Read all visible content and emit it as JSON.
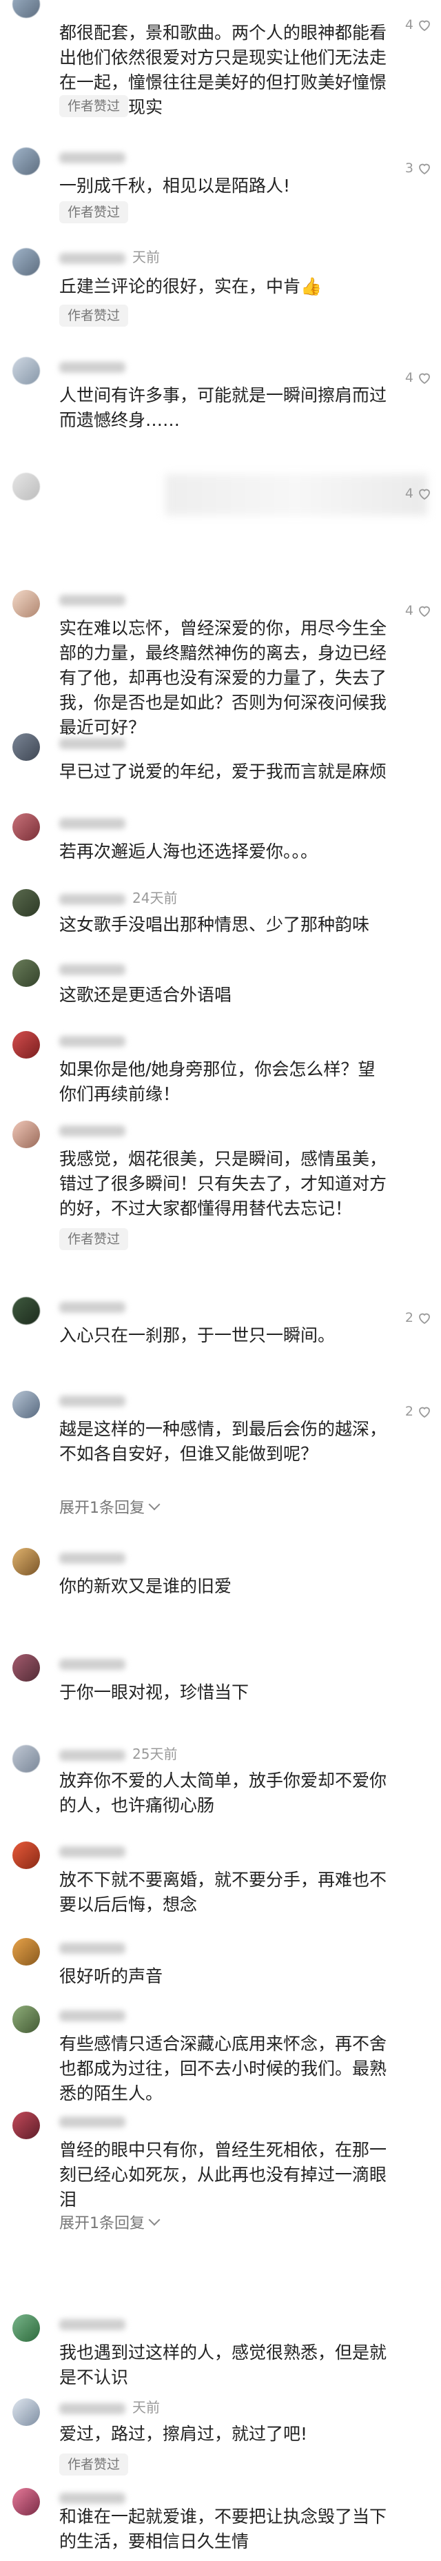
{
  "heart_icon": "heart-outline-icon",
  "expand_icon": "chevron-down-icon",
  "comments": [
    {
      "name": "",
      "time": "",
      "text": "都很配套，景和歌曲。两个人的眼神都能看出他们依然很爱对方只是现实让他们无法走在一起，憧憬往往是美好的但打败美好憧憬的往往是现实",
      "badge": "作者赞过",
      "likes": "4",
      "expand": ""
    },
    {
      "name": "",
      "time": "",
      "text": "一别成千秋，相见以是陌路人!",
      "badge": "作者赞过",
      "likes": "3",
      "expand": ""
    },
    {
      "name": "",
      "time": "天前",
      "text": "丘建兰评论的很好，实在，中肯👍",
      "badge": "作者赞过",
      "likes": "",
      "expand": ""
    },
    {
      "name": "",
      "time": "",
      "text": "人世间有许多事，可能就是一瞬间擦肩而过而遗憾终身……",
      "badge": "",
      "likes": "4",
      "expand": ""
    },
    {
      "name": "",
      "time": "",
      "text": "",
      "badge": "",
      "likes": "4",
      "expand": ""
    },
    {
      "name": "",
      "time": "",
      "text": "实在难以忘怀，曾经深爱的你，用尽今生全部的力量，最终黯然神伤的离去，身边已经有了他，却再也没有深爱的力量了，失去了我，你是否也是如此？否则为何深夜问候我最近可好？",
      "badge": "",
      "likes": "4",
      "expand": ""
    },
    {
      "name": "",
      "time": "",
      "text": "早已过了说爱的年纪，爱于我而言就是麻烦",
      "badge": "",
      "likes": "",
      "expand": ""
    },
    {
      "name": "",
      "time": "",
      "text": "若再次邂逅人海也还选择爱你。。。",
      "badge": "",
      "likes": "",
      "expand": ""
    },
    {
      "name": "",
      "time": "24天前",
      "text": "这女歌手没唱出那种情思、少了那种韵味",
      "badge": "",
      "likes": "",
      "expand": ""
    },
    {
      "name": "",
      "time": "",
      "text": "这歌还是更适合外语唱",
      "badge": "",
      "likes": "",
      "expand": ""
    },
    {
      "name": "",
      "time": "",
      "text": "如果你是他/她身旁那位，你会怎么样？望你们再续前缘！",
      "badge": "",
      "likes": "",
      "expand": ""
    },
    {
      "name": "",
      "time": "",
      "text": "我感觉，烟花很美，只是瞬间，感情虽美，错过了很多瞬间！只有失去了，才知道对方的好，不过大家都懂得用替代去忘记！",
      "badge": "作者赞过",
      "likes": "",
      "expand": ""
    },
    {
      "name": "",
      "time": "",
      "text": "入心只在一刹那，于一世只一瞬间。",
      "badge": "",
      "likes": "2",
      "expand": ""
    },
    {
      "name": "",
      "time": "",
      "text": "越是这样的一种感情，到最后会伤的越深，不如各自安好，但谁又能做到呢？",
      "badge": "",
      "likes": "2",
      "expand": "展开1条回复"
    },
    {
      "name": "",
      "time": "",
      "text": "你的新欢又是谁的旧爱",
      "badge": "",
      "likes": "",
      "expand": ""
    },
    {
      "name": "",
      "time": "",
      "text": "于你一眼对视，珍惜当下",
      "badge": "",
      "likes": "",
      "expand": ""
    },
    {
      "name": "",
      "time": "25天前",
      "text": "放弃你不爱的人太简单，放手你爱却不爱你的人，也许痛彻心肠",
      "badge": "",
      "likes": "",
      "expand": ""
    },
    {
      "name": "",
      "time": "",
      "text": "放不下就不要离婚，就不要分手，再难也不要以后后悔，想念",
      "badge": "",
      "likes": "",
      "expand": ""
    },
    {
      "name": "",
      "time": "",
      "text": "很好听的声音",
      "badge": "",
      "likes": "",
      "expand": ""
    },
    {
      "name": "",
      "time": "",
      "text": "有些感情只适合深藏心底用来怀念，再不舍也都成为过往，回不去小时候的我们。最熟悉的陌生人。",
      "badge": "",
      "likes": "",
      "expand": ""
    },
    {
      "name": "",
      "time": "",
      "text": "曾经的眼中只有你，曾经生死相依，在那一刻已经心如死灰，从此再也没有掉过一滴眼泪",
      "badge": "",
      "likes": "",
      "expand": "展开1条回复"
    },
    {
      "name": "",
      "time": "",
      "text": "我也遇到过这样的人，感觉很熟悉，但是就是不认识",
      "badge": "",
      "likes": "",
      "expand": ""
    },
    {
      "name": "",
      "time": "天前",
      "text": "爱过，路过，擦肩过，就过了吧!",
      "badge": "作者赞过",
      "likes": "",
      "expand": ""
    },
    {
      "name": "",
      "time": "",
      "text": "和谁在一起就爱谁，不要把让执念毁了当下的生活，要相信日久生情",
      "badge": "",
      "likes": "",
      "expand": ""
    }
  ]
}
